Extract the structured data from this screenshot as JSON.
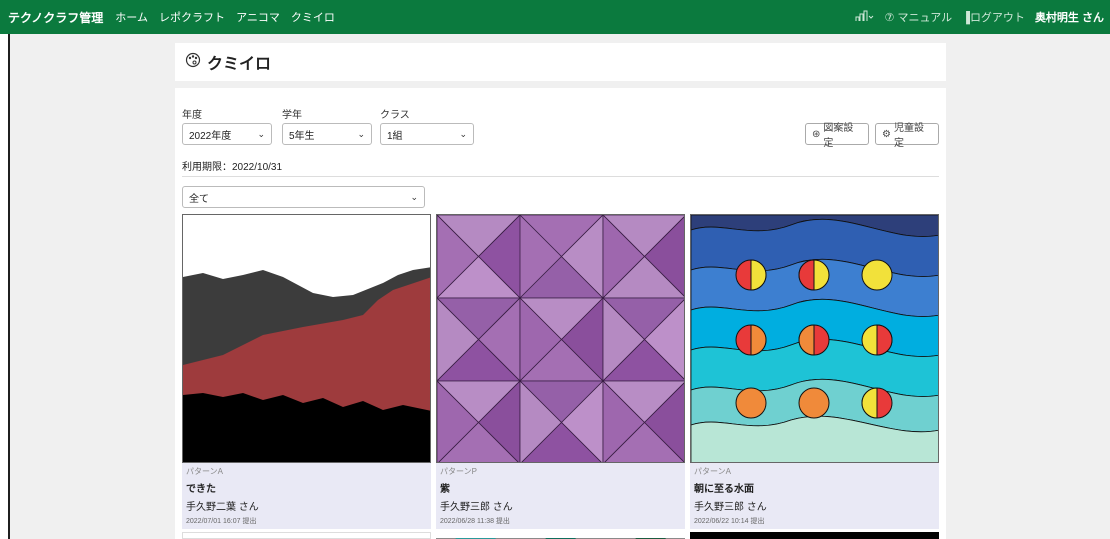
{
  "header": {
    "brand": "テクノクラフ管理",
    "nav": [
      "ホーム",
      "レポクラフト",
      "アニコマ",
      "クミイロ"
    ],
    "manual_label": "マニュアル",
    "logout_label": "ログアウト",
    "user_name": "奥村明生 さん"
  },
  "page": {
    "title": "クミイロ"
  },
  "filters": {
    "year_label": "年度",
    "year_value": "2022年度",
    "grade_label": "学年",
    "grade_value": "5年生",
    "class_label": "クラス",
    "class_value": "1組",
    "pattern_settings": "図案設定",
    "student_settings": "児童設定",
    "period_label": "利用期限：2022/10/31",
    "filter_value": "全て"
  },
  "works": [
    {
      "pattern": "パターンA",
      "title": "できた",
      "author": "手久野二葉 さん",
      "date": "2022/07/01 16:07 提出"
    },
    {
      "pattern": "パターンP",
      "title": "紫",
      "author": "手久野三郎 さん",
      "date": "2022/06/28 11:38 提出"
    },
    {
      "pattern": "パターンA",
      "title": "朝に至る水面",
      "author": "手久野三郎 さん",
      "date": "2022/06/22 10:14 提出"
    }
  ],
  "colors": {
    "topbar": "#0b7a3e",
    "card_meta": "#e9e9f5"
  }
}
